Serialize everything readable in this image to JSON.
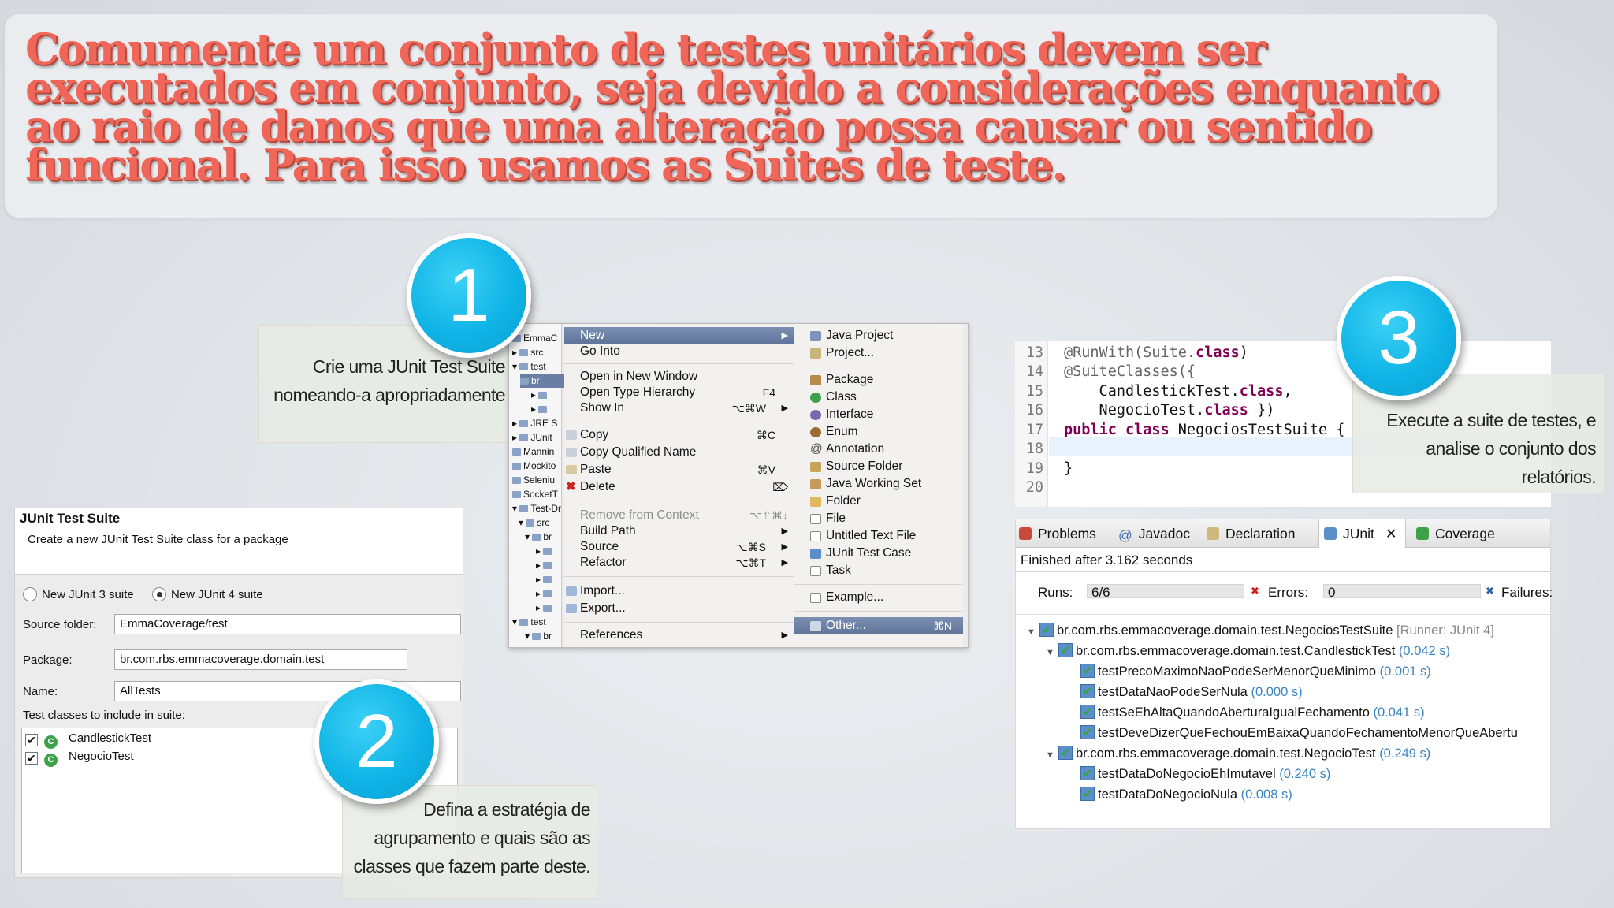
{
  "banner": {
    "text": "Comumente um conjunto de testes unitários devem ser executados em conjunto, seja devido a considerações enquanto ao raio de danos que uma alteração possa causar ou sentido funcional. Para isso usamos as Suites de teste."
  },
  "steps": [
    {
      "number": "1",
      "caption": "Crie uma JUnit Test Suite nomeando-a apropriadamente"
    },
    {
      "number": "2",
      "caption": "Defina a estratégia de agrupamento e quais são as classes que fazem parte deste."
    },
    {
      "number": "3",
      "caption": "Execute a suite de testes, e analise o conjunto dos relatórios."
    }
  ],
  "project_tree": {
    "items": [
      "EmmaC",
      "src",
      "test",
      "br",
      "JRE S",
      "JUnit",
      "Mannin",
      "Mockito",
      "Seleniu",
      "SocketT",
      "Test-Dr",
      "src",
      "br",
      "test",
      "br"
    ]
  },
  "context_menu": {
    "items": [
      {
        "label": "New",
        "shortcut": "",
        "arrow": "▶",
        "selected": true
      },
      {
        "label": "Go Into",
        "shortcut": ""
      },
      {
        "label": "Open in New Window",
        "shortcut": ""
      },
      {
        "label": "Open Type Hierarchy",
        "shortcut": "F4"
      },
      {
        "label": "Show In",
        "shortcut": "⌥⌘W",
        "arrow": "▶"
      },
      {
        "label": "Copy",
        "shortcut": "⌘C"
      },
      {
        "label": "Copy Qualified Name",
        "shortcut": ""
      },
      {
        "label": "Paste",
        "shortcut": "⌘V"
      },
      {
        "label": "Delete",
        "shortcut": "⌦"
      },
      {
        "label": "Remove from Context",
        "shortcut": "⌥⇧⌘↓",
        "disabled": true
      },
      {
        "label": "Build Path",
        "shortcut": "",
        "arrow": "▶"
      },
      {
        "label": "Source",
        "shortcut": "⌥⌘S",
        "arrow": "▶"
      },
      {
        "label": "Refactor",
        "shortcut": "⌥⌘T",
        "arrow": "▶"
      },
      {
        "label": "Import...",
        "shortcut": ""
      },
      {
        "label": "Export...",
        "shortcut": ""
      },
      {
        "label": "References",
        "shortcut": "",
        "arrow": "▶"
      }
    ]
  },
  "new_submenu": {
    "items": [
      {
        "label": "Java Project",
        "icon": "java-project-icon"
      },
      {
        "label": "Project...",
        "icon": "project-icon"
      },
      {
        "label": "Package",
        "icon": "package-icon"
      },
      {
        "label": "Class",
        "icon": "class-icon"
      },
      {
        "label": "Interface",
        "icon": "interface-icon"
      },
      {
        "label": "Enum",
        "icon": "enum-icon"
      },
      {
        "label": "Annotation",
        "icon": "annotation-icon"
      },
      {
        "label": "Source Folder",
        "icon": "source-folder-icon"
      },
      {
        "label": "Java Working Set",
        "icon": "working-set-icon"
      },
      {
        "label": "Folder",
        "icon": "folder-icon"
      },
      {
        "label": "File",
        "icon": "file-icon"
      },
      {
        "label": "Untitled Text File",
        "icon": "text-file-icon"
      },
      {
        "label": "JUnit Test Case",
        "icon": "junit-test-case-icon"
      },
      {
        "label": "Task",
        "icon": "task-icon"
      },
      {
        "label": "Example...",
        "icon": "example-icon"
      },
      {
        "label": "Other...",
        "icon": "other-icon",
        "shortcut": "⌘N",
        "selected": true
      }
    ]
  },
  "dialog": {
    "title": "JUnit Test Suite",
    "subtitle": "Create a new JUnit Test Suite class for a package",
    "radio_junit3": "New JUnit 3 suite",
    "radio_junit4": "New JUnit 4 suite",
    "source_folder_label": "Source folder:",
    "source_folder_value": "EmmaCoverage/test",
    "package_label": "Package:",
    "package_value": "br.com.rbs.emmacoverage.domain.test",
    "name_label": "Name:",
    "name_value": "AllTests",
    "classes_label": "Test classes to include in suite:",
    "classes": [
      "CandlestickTest",
      "NegocioTest"
    ]
  },
  "code": {
    "line_numbers": [
      "13",
      "14",
      "15",
      "16",
      "17",
      "18",
      "19",
      "20"
    ],
    "lines": [
      [
        "@RunWith(Suite.",
        "class",
        ")"
      ],
      [
        "@SuiteClasses({",
        "",
        ""
      ],
      [
        "    CandlestickTest.",
        "class",
        ","
      ],
      [
        "    NegocioTest.",
        "class",
        " })"
      ],
      [
        "",
        "public class",
        " NegociosTestSuite {"
      ],
      [
        "",
        "",
        ""
      ],
      [
        "}",
        "",
        ""
      ],
      [
        "",
        "",
        ""
      ]
    ]
  },
  "junit_view": {
    "tabs": [
      "Problems",
      "Javadoc",
      "Declaration",
      "JUnit",
      "Coverage"
    ],
    "status": "Finished after 3.162 seconds",
    "runs_label": "Runs:",
    "runs_value": "6/6",
    "errors_label": "Errors:",
    "errors_value": "0",
    "failures_label": "Failures:",
    "tree": [
      {
        "name": "br.com.rbs.emmacoverage.domain.test.NegociosTestSuite",
        "time": "",
        "runner": "[Runner: JUnit 4]"
      },
      {
        "name": "br.com.rbs.emmacoverage.domain.test.CandlestickTest",
        "time": "(0.042 s)"
      },
      {
        "name": "testPrecoMaximoNaoPodeSerMenorQueMinimo",
        "time": "(0.001 s)"
      },
      {
        "name": "testDataNaoPodeSerNula",
        "time": "(0.000 s)"
      },
      {
        "name": "testSeEhAltaQuandoAberturaIgualFechamento",
        "time": "(0.041 s)"
      },
      {
        "name": "testDeveDizerQueFechouEmBaixaQuandoFechamentoMenorQueAbertu",
        "time": ""
      },
      {
        "name": "br.com.rbs.emmacoverage.domain.test.NegocioTest",
        "time": "(0.249 s)"
      },
      {
        "name": "testDataDoNegocioEhImutavel",
        "time": "(0.240 s)"
      },
      {
        "name": "testDataDoNegocioNula",
        "time": "(0.008 s)"
      }
    ]
  },
  "colors": {
    "banner_text": "#f0675a",
    "step_circle": "#10b4e6",
    "menu_selection": "#6a7fa3",
    "keyword": "#7f0055",
    "time_text": "#3a84c0"
  }
}
